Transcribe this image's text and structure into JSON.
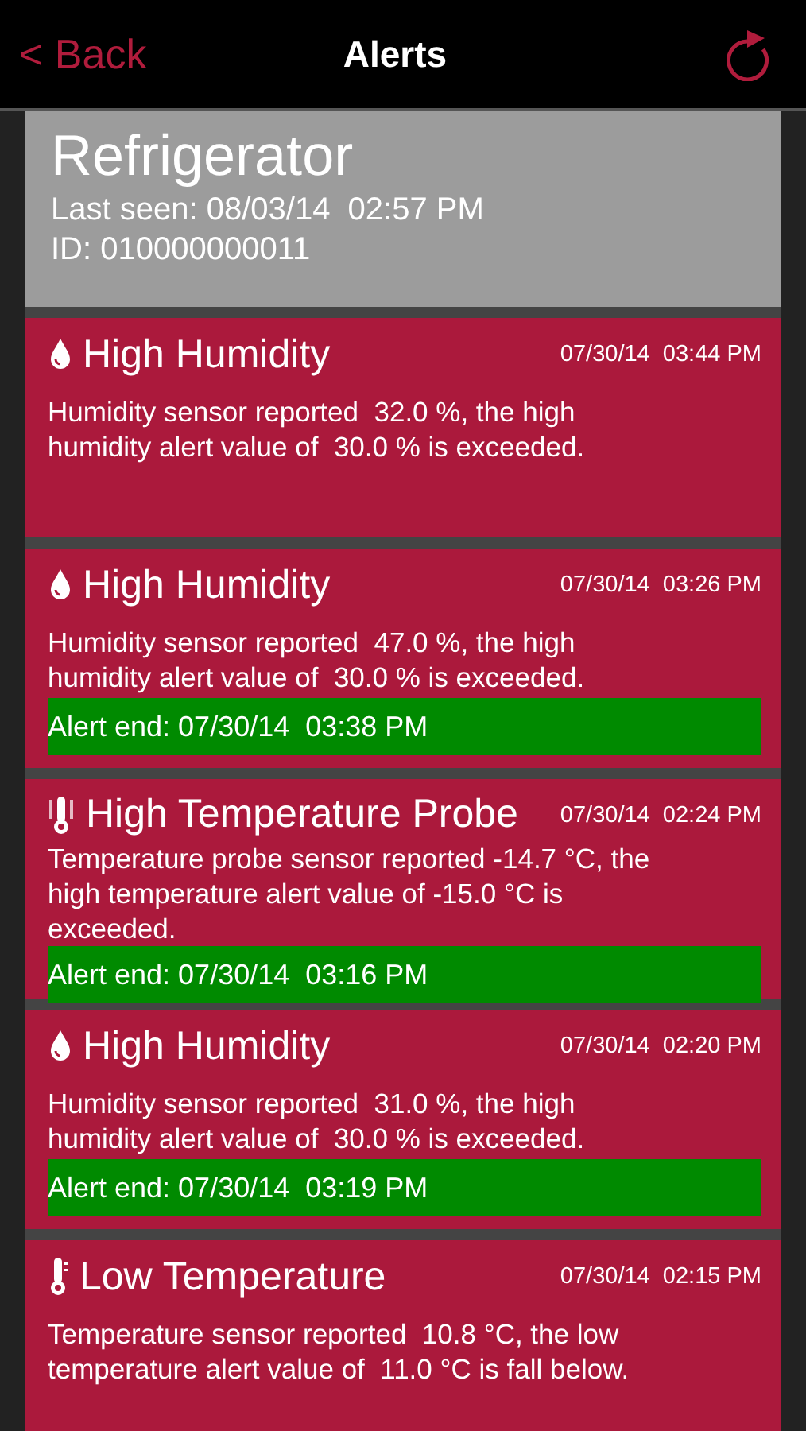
{
  "nav": {
    "back": "< Back",
    "title": "Alerts"
  },
  "device": {
    "name": "Refrigerator",
    "last_seen": "Last seen: 08/03/14  02:57 PM",
    "id": "ID: 010000000011"
  },
  "alerts": [
    {
      "kind": "humidity",
      "title": "High Humidity",
      "time": "07/30/14  03:44 PM",
      "message": "Humidity sensor reported  32.0 %, the high humidity alert value of  30.0 % is exceeded."
    },
    {
      "kind": "humidity",
      "title": "High Humidity",
      "time": "07/30/14  03:26 PM",
      "message": "Humidity sensor reported  47.0 %, the high humidity alert value of  30.0 % is exceeded.",
      "alert_end": "Alert end: 07/30/14  03:38 PM"
    },
    {
      "kind": "probe",
      "title": "High Temperature Probe",
      "time": "07/30/14  02:24 PM",
      "message": "Temperature probe sensor reported -14.7 °C, the high temperature alert value of -15.0 °C is exceeded.",
      "alert_end": "Alert end: 07/30/14  03:16 PM"
    },
    {
      "kind": "humidity",
      "title": "High Humidity",
      "time": "07/30/14  02:20 PM",
      "message": "Humidity sensor reported  31.0 %, the high humidity alert value of  30.0 % is exceeded.",
      "alert_end": "Alert end: 07/30/14  03:19 PM"
    },
    {
      "kind": "temperature",
      "title": "Low Temperature",
      "time": "07/30/14  02:15 PM",
      "message": "Temperature sensor reported  10.8 °C, the low temperature alert value of  11.0 °C is fall below."
    }
  ]
}
